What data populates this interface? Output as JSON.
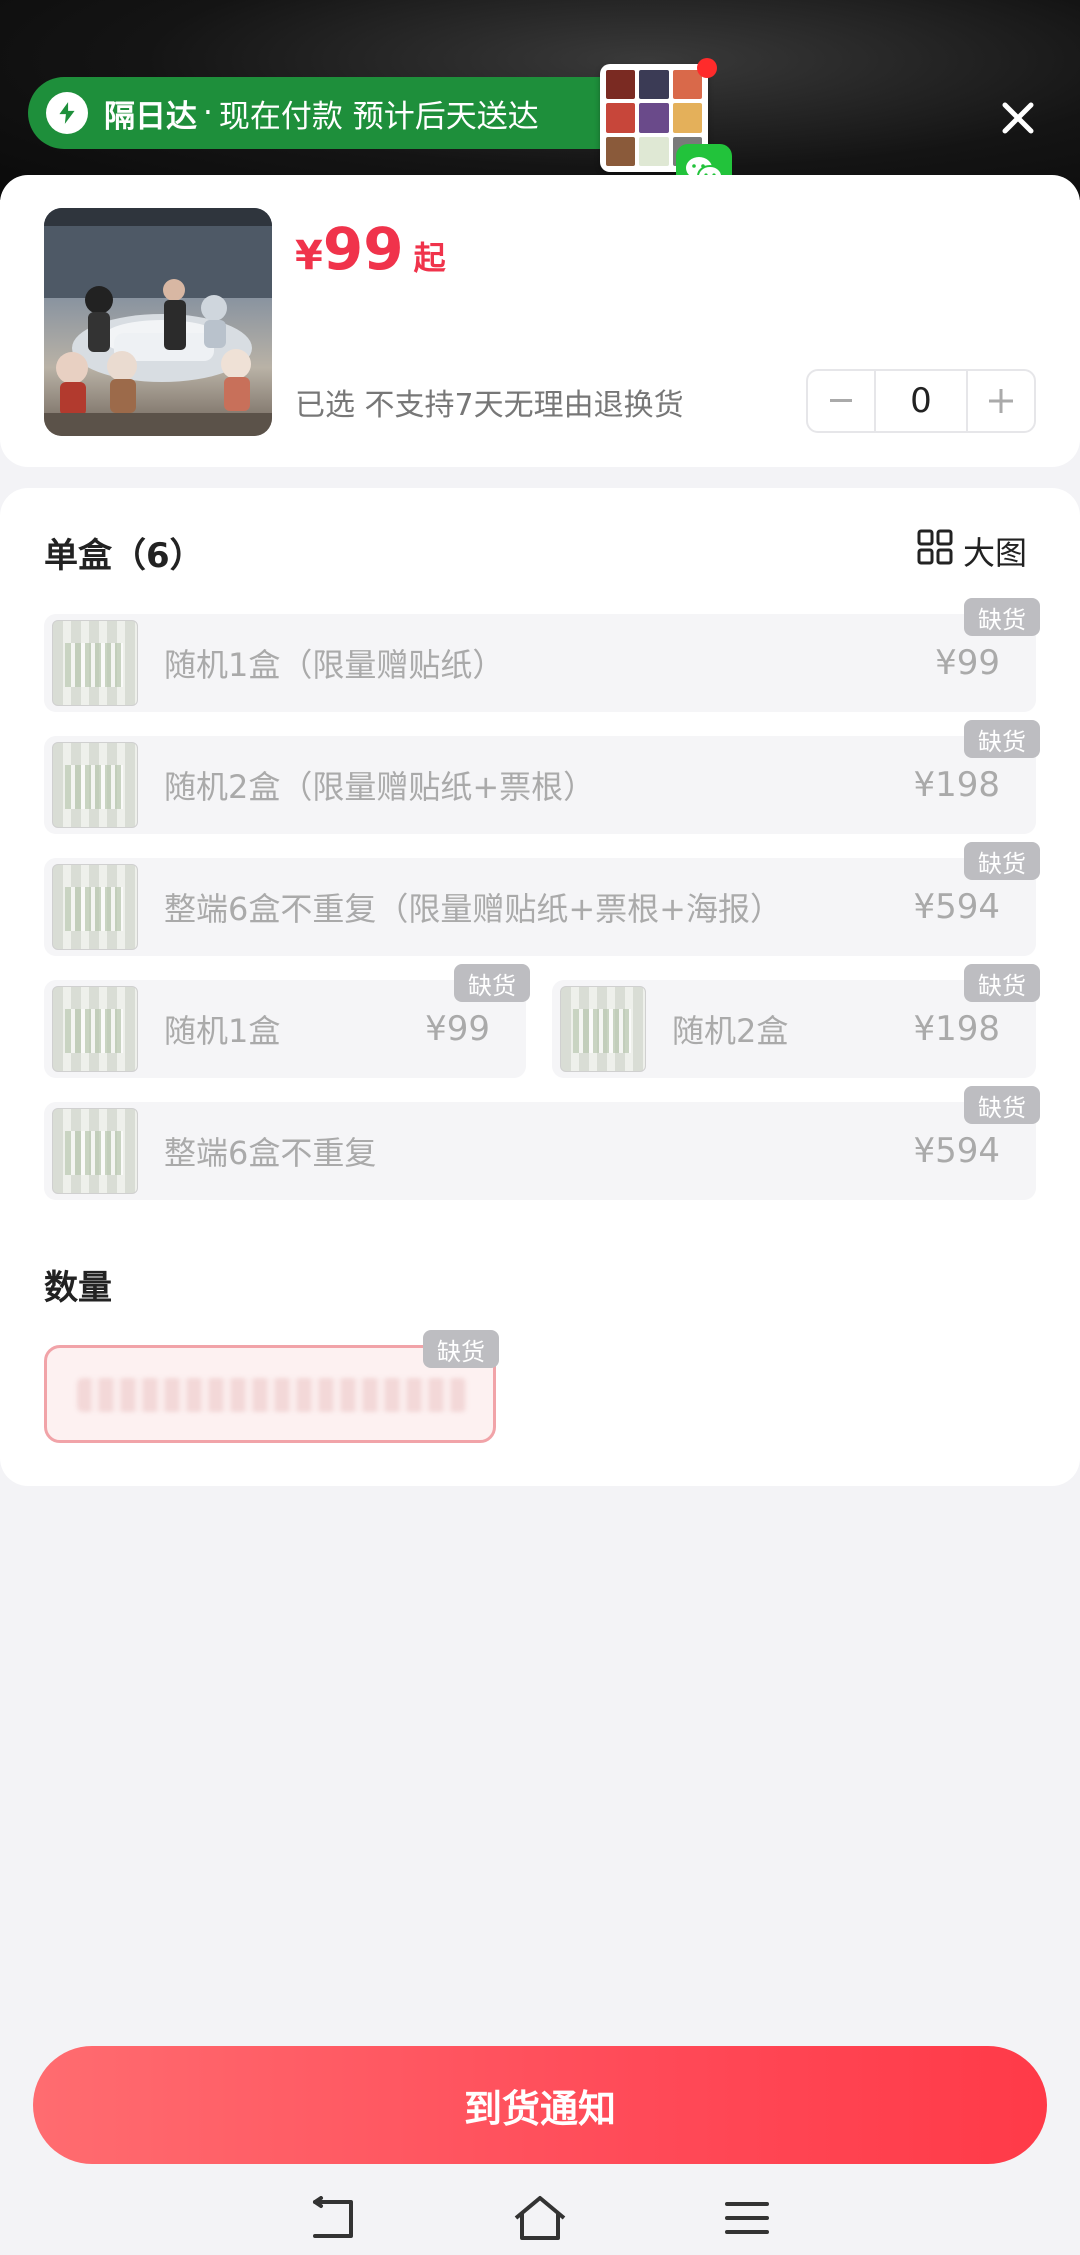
{
  "header": {
    "delivery_brand": "隔日达",
    "delivery_separator": "·",
    "delivery_text": "现在付款 预计后天送达"
  },
  "product": {
    "currency": "¥",
    "price": "99",
    "price_suffix": "起",
    "selected_text": "已选 不支持7天无理由退换货",
    "quantity": "0"
  },
  "single_box": {
    "title": "单盒（6）",
    "big_view_label": "大图",
    "out_of_stock_label": "缺货",
    "options": [
      {
        "label": "随机1盒（限量赠贴纸）",
        "price": "¥99",
        "out_of_stock": true
      },
      {
        "label": "随机2盒（限量赠贴纸+票根）",
        "price": "¥198",
        "out_of_stock": true
      },
      {
        "label": "整端6盒不重复（限量赠贴纸+票根+海报）",
        "price": "¥594",
        "out_of_stock": true
      },
      {
        "label": "随机1盒",
        "price": "¥99",
        "out_of_stock": true
      },
      {
        "label": "随机2盒",
        "price": "¥198",
        "out_of_stock": true
      },
      {
        "label": "整端6盒不重复",
        "price": "¥594",
        "out_of_stock": true
      }
    ]
  },
  "quantity_section": {
    "title": "数量",
    "out_of_stock_label": "缺货"
  },
  "bottom": {
    "notify_button": "到货通知"
  },
  "colors": {
    "accent": "#f0334b",
    "delivery_green": "#1e8f3b",
    "wechat_green": "#22c33b"
  },
  "icons": [
    "bolt-icon",
    "wechat-icon",
    "close-icon",
    "grid-icon",
    "minus-icon",
    "plus-icon",
    "back-icon",
    "home-icon",
    "menu-icon"
  ]
}
